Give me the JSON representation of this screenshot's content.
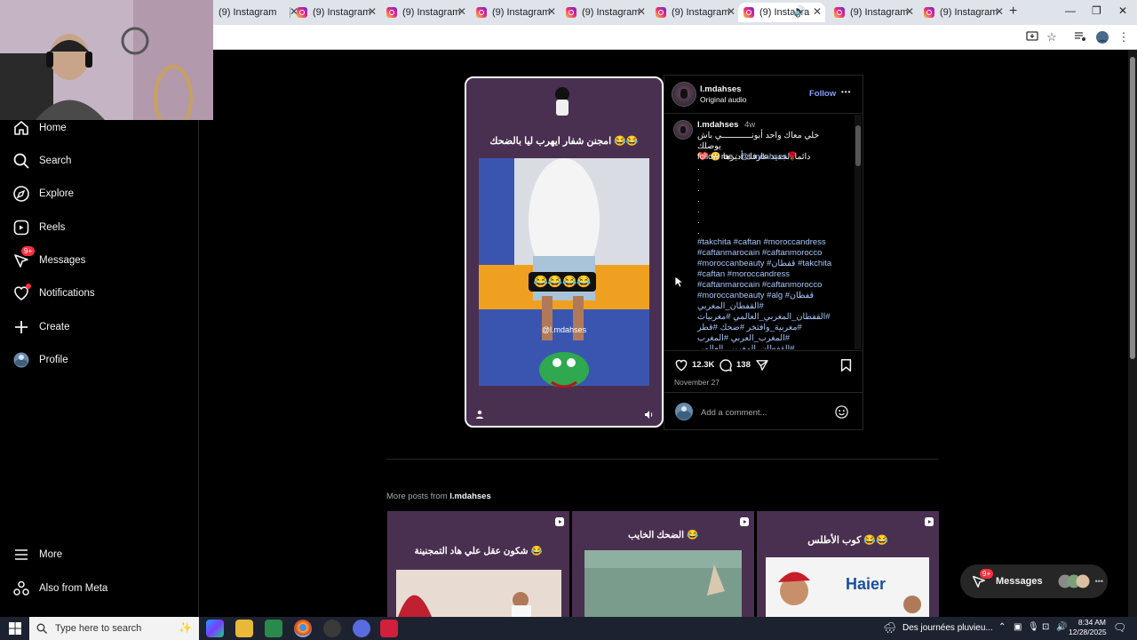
{
  "browser": {
    "tabs": [
      {
        "title": "(9) Instagram"
      },
      {
        "title": "(9) Instagram"
      },
      {
        "title": "(9) Instagram"
      },
      {
        "title": "(9) Instagram"
      },
      {
        "title": "(9) Instagram"
      },
      {
        "title": "(9) Instagram"
      },
      {
        "title": "(9) Instagra"
      },
      {
        "title": "(9) Instagram"
      },
      {
        "title": "(9) Instagram"
      }
    ],
    "new_tab_glyph": "+",
    "window_controls": [
      "—",
      "❐",
      "✕"
    ]
  },
  "sidebar": {
    "items": [
      {
        "label": "Home",
        "icon": "home-icon"
      },
      {
        "label": "Search",
        "icon": "search-icon"
      },
      {
        "label": "Explore",
        "icon": "explore-icon"
      },
      {
        "label": "Reels",
        "icon": "reels-icon"
      },
      {
        "label": "Messages",
        "icon": "messenger-icon",
        "badge": "9+"
      },
      {
        "label": "Notifications",
        "icon": "heart-icon"
      },
      {
        "label": "Create",
        "icon": "plus-icon"
      },
      {
        "label": "Profile",
        "icon": "avatar"
      }
    ],
    "bottom": [
      {
        "label": "More",
        "icon": "menu-icon"
      },
      {
        "label": "Also from Meta",
        "icon": "meta-icon"
      }
    ]
  },
  "post": {
    "media": {
      "caption_ar": "امجنن شفار ايهرب ليا بالضحك 😂😂",
      "emoji_row": "😂😂😂😂",
      "watermark": "@l.mdahses"
    },
    "author": {
      "username": "l.mdahses",
      "audio": "Original audio",
      "follow_label": "Follow",
      "more_glyph": "•••"
    },
    "caption": {
      "username": "l.mdahses",
      "age": "4w",
      "lines": [
        "خلي معاك واحد أبونــــــــــــي باش يوصلك",
        "دائما الجديد عارفك أديرها 😊 ❤️"
      ],
      "follow_prefix": "follow me : ",
      "follow_handle": "@l.mdahses",
      "dots": [
        ".",
        ".",
        ".",
        ".",
        ".",
        ".",
        "."
      ],
      "hashtags": "#takchita #caftan #moroccandress #caftanmarocain #caftanmorocco #moroccanbeauty #قفطان #takchita #caftan #moroccandress #caftanmarocain #caftanmorocco #moroccanbeauty #alg #قفطان #القفطان_المغربي #القفطان_المغربي_العالمي #مغربيات #مغربية_وافتخر #ضحك #قطر #المغرب_العربي #المغرب #القفطان_المغربي_العالمي"
    },
    "likes": "12.3K",
    "comments": "138",
    "date": "November 27",
    "comment_placeholder": "Add a comment..."
  },
  "more_posts": {
    "heading_prefix": "More posts from ",
    "heading_user": "l.mdahses",
    "thumbnails": [
      {
        "caption": "شكون عقل علي هاد التمجنينة 😂"
      },
      {
        "caption": "الضحك الخايب 😂",
        "brand": ""
      },
      {
        "caption": "كوب الأطلس 😂😂",
        "brand": "Haier"
      }
    ]
  },
  "floating_messages": {
    "label": "Messages",
    "badge": "9+"
  },
  "taskbar": {
    "search_placeholder": "Type here to search",
    "weather": "Des journées pluvieu...",
    "time": "8:34 AM",
    "date": "12/28/2025"
  },
  "colors": {
    "background": "#000000",
    "accent_blue": "#a8c7fa",
    "follow_blue": "#85a1ff",
    "badge_red": "#ff3040",
    "media_purple": "#4a3050"
  }
}
